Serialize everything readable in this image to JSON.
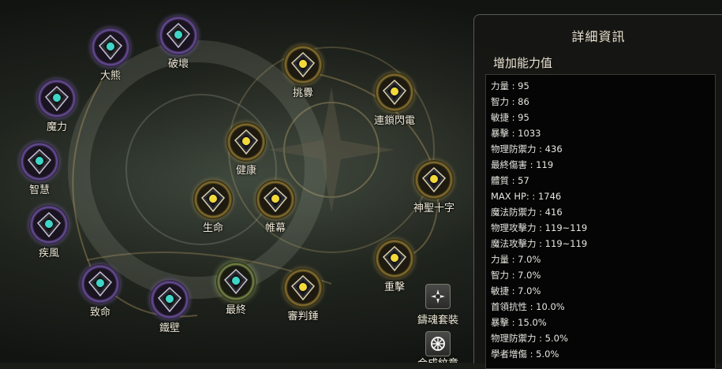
{
  "skill_tree": {
    "nodes": [
      {
        "id": "dashiong",
        "label": "大熊",
        "style": "purple",
        "icon": "bear-rune-icon"
      },
      {
        "id": "pohuai",
        "label": "破壞",
        "style": "purple",
        "icon": "destroy-rune-icon"
      },
      {
        "id": "moli",
        "label": "魔力",
        "style": "purple",
        "icon": "magic-rune-icon"
      },
      {
        "id": "zhihui",
        "label": "智慧",
        "style": "purple",
        "icon": "wisdom-rune-icon"
      },
      {
        "id": "jifeng",
        "label": "疾風",
        "style": "purple",
        "icon": "gale-rune-icon"
      },
      {
        "id": "zhiming",
        "label": "致命",
        "style": "purple",
        "icon": "fatal-rune-icon"
      },
      {
        "id": "tiebi",
        "label": "鐵壁",
        "style": "purple",
        "icon": "iron-wall-rune-icon"
      },
      {
        "id": "zuizhong",
        "label": "最終",
        "style": "green",
        "icon": "final-rune-icon"
      },
      {
        "id": "shenpanchui",
        "label": "審判錘",
        "style": "gold",
        "icon": "judgement-hammer-icon"
      },
      {
        "id": "tiaoxin",
        "label": "挑釁",
        "style": "gold",
        "icon": "provoke-icon"
      },
      {
        "id": "lianshuo",
        "label": "連鎖閃電",
        "style": "gold",
        "icon": "chain-lightning-icon"
      },
      {
        "id": "shensheng",
        "label": "神聖十字",
        "style": "gold",
        "icon": "holy-cross-icon"
      },
      {
        "id": "zhongji",
        "label": "重擊",
        "style": "gold",
        "icon": "heavy-strike-icon"
      },
      {
        "id": "jiankang",
        "label": "健康",
        "style": "gold",
        "icon": "health-heart-icon"
      },
      {
        "id": "shengming",
        "label": "生命",
        "style": "gold",
        "icon": "life-heart-icon"
      },
      {
        "id": "weimu",
        "label": "帷幕",
        "style": "gold",
        "icon": "veil-shield-icon"
      }
    ],
    "side_buttons": [
      {
        "id": "soul-set",
        "label": "鑄魂套裝",
        "icon": "soul-set-icon"
      },
      {
        "id": "synthesis",
        "label": "合成紋章",
        "icon": "synthesis-icon"
      }
    ]
  },
  "details": {
    "title": "詳細資訊",
    "subtitle": "增加能力值",
    "stats": [
      "力量 : 95",
      "智力 : 86",
      "敏捷 : 95",
      "暴擊 : 1033",
      "物理防禦力 : 436",
      "最終傷害 : 119",
      "體質 : 57",
      "MAX HP:   : 1746",
      "魔法防禦力 : 416",
      "物理攻擊力 : 119~119",
      "魔法攻擊力 : 119~119",
      "力量 : 7.0%",
      "智力 : 7.0%",
      "敏捷 : 7.0%",
      "首領抗性 : 10.0%",
      "暴擊 : 15.0%",
      "物理防禦力 : 5.0%",
      "學者增傷 : 5.0%"
    ]
  },
  "colors": {
    "purple_ring": "#a892d0",
    "gold_ring": "#e2c35a",
    "teal_icon": "#3fd6c8",
    "yellow_icon": "#f2d93a"
  }
}
